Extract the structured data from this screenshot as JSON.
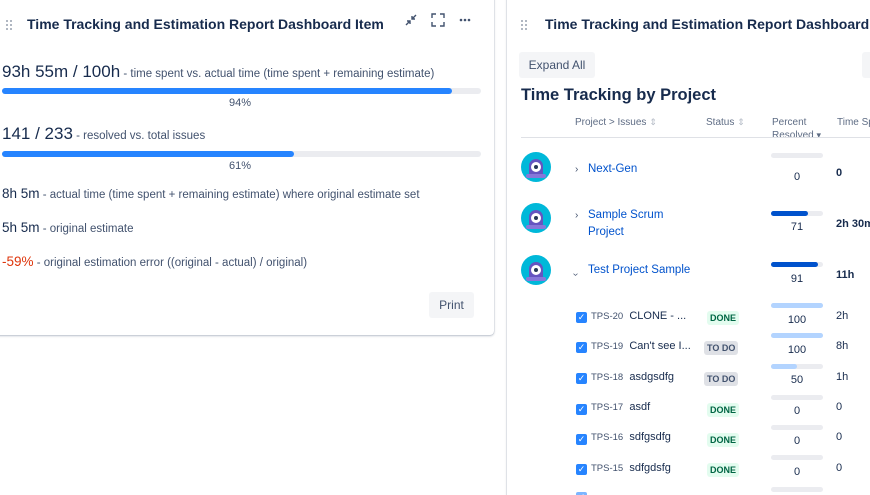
{
  "left_card": {
    "title": "Time Tracking and Estimation Report Dashboard Item",
    "icons": [
      "minimize-icon",
      "fullscreen-icon",
      "more-icon"
    ],
    "metric1": {
      "value": "93h 55m / 100h",
      "desc": " - time spent vs. actual time (time spent + remaining estimate)",
      "progress": 0.94,
      "pct_label": "94%"
    },
    "metric2": {
      "value": "141 / 233",
      "desc": " - resolved vs. total issues",
      "progress": 0.61,
      "pct_label": "61%"
    },
    "metric3": {
      "value": "8h 5m",
      "desc": " - actual time (time spent + remaining estimate) where original estimate set"
    },
    "metric4": {
      "value": "5h 5m",
      "desc": " - original estimate"
    },
    "metric5": {
      "value": "-59%",
      "desc": " - original estimation error ((original - actual) / original)"
    },
    "print_label": "Print"
  },
  "right_card": {
    "title": "Time Tracking and Estimation Report Dashboard Item",
    "expand_label": "Expand All",
    "section_title": "Time Tracking by Project",
    "headers": {
      "project": "Project > Issues",
      "status": "Status",
      "percent_1": "Percent",
      "percent_2": "Resolved",
      "time": "Time Sp"
    },
    "projects": [
      {
        "name": "Next-Gen",
        "percent": "0",
        "progress": 0,
        "time": "0"
      },
      {
        "name_1": "Sample Scrum",
        "name_2": "Project",
        "percent": "71",
        "progress": 0.71,
        "time": "2h 30m"
      },
      {
        "name": "Test Project Sample",
        "percent": "91",
        "progress": 0.91,
        "time": "11h"
      }
    ],
    "issues": [
      {
        "key": "TPS-20",
        "summary": "CLONE - ...",
        "status": "DONE",
        "percent": "100",
        "progress": 1.0,
        "time": "2h"
      },
      {
        "key": "TPS-19",
        "summary": "Can't see I...",
        "status": "TO DO",
        "percent": "100",
        "progress": 1.0,
        "time": "8h"
      },
      {
        "key": "TPS-18",
        "summary": "asdgsdfg",
        "status": "TO DO",
        "percent": "50",
        "progress": 0.5,
        "time": "1h"
      },
      {
        "key": "TPS-17",
        "summary": "asdf",
        "status": "DONE",
        "percent": "0",
        "progress": 0,
        "time": "0"
      },
      {
        "key": "TPS-16",
        "summary": "sdfgsdfg",
        "status": "DONE",
        "percent": "0",
        "progress": 0,
        "time": "0"
      },
      {
        "key": "TPS-15",
        "summary": "sdfgdsfg",
        "status": "DONE",
        "percent": "0",
        "progress": 0,
        "time": "0"
      }
    ]
  },
  "colors": {
    "accent": "#2684ff",
    "link": "#0052cc",
    "negative": "#de350b",
    "done": "#006644",
    "done_bg": "#e3fcef"
  }
}
